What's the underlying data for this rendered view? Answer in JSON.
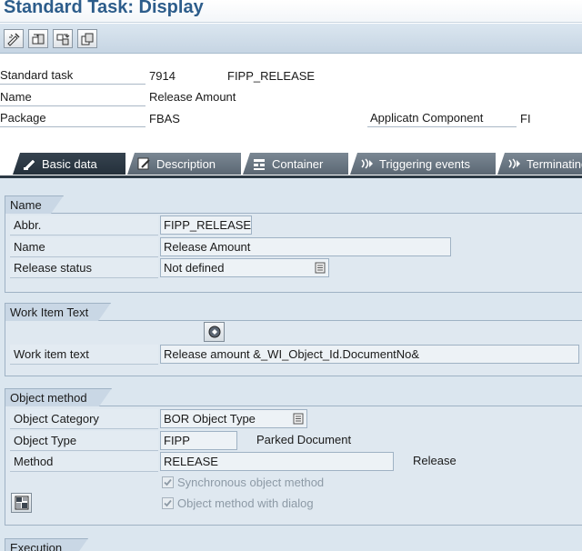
{
  "window": {
    "title": "Standard Task: Display"
  },
  "toolbar": {
    "buttons": [
      {
        "icon": "other-object-icon"
      },
      {
        "icon": "where-used-icon"
      },
      {
        "icon": "transport-icon"
      },
      {
        "icon": "copy-icon"
      }
    ]
  },
  "header": {
    "standard_task": {
      "label": "Standard task",
      "id": "7914",
      "code": "FIPP_RELEASE"
    },
    "name": {
      "label": "Name",
      "value": "Release Amount"
    },
    "package": {
      "label": "Package",
      "value": "FBAS"
    },
    "app_component": {
      "label": "Applicatn Component",
      "value": "FI"
    }
  },
  "tabs": [
    {
      "label": "Basic data",
      "icon": "basic-data-icon",
      "active": true
    },
    {
      "label": "Description",
      "icon": "description-icon",
      "active": false
    },
    {
      "label": "Container",
      "icon": "container-icon",
      "active": false
    },
    {
      "label": "Triggering events",
      "icon": "triggering-events-icon",
      "active": false
    },
    {
      "label": "Terminating events",
      "icon": "terminating-events-icon",
      "active": false
    }
  ],
  "name_group": {
    "title": "Name",
    "abbr": {
      "label": "Abbr.",
      "value": "FIPP_RELEASE"
    },
    "name": {
      "label": "Name",
      "value": "Release Amount"
    },
    "release_status": {
      "label": "Release status",
      "value": "Not defined"
    }
  },
  "work_item_group": {
    "title": "Work Item Text",
    "work_item_text": {
      "label": "Work item text",
      "value": "Release amount &_WI_Object_Id.DocumentNo&"
    }
  },
  "object_method_group": {
    "title": "Object method",
    "object_category": {
      "label": "Object Category",
      "value": "BOR Object Type"
    },
    "object_type": {
      "label": "Object Type",
      "value": "FIPP",
      "description": "Parked Document"
    },
    "method": {
      "label": "Method",
      "value": "RELEASE",
      "description": "Release"
    },
    "synchronous": {
      "label": "Synchronous object method",
      "checked": true
    },
    "with_dialog": {
      "label": "Object method with dialog",
      "checked": true
    }
  },
  "execution_group": {
    "title": "Execution"
  },
  "colors": {
    "title": "#2d5d8b",
    "content_bg": "#dbe6ef",
    "tab_active": "#24303b",
    "tab_inactive": "#5b6773"
  }
}
